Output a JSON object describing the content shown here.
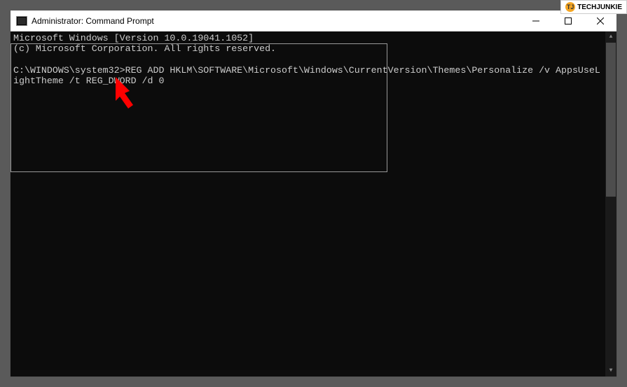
{
  "watermark": {
    "label": "TECHJUNKIE",
    "icon_letter": "TJ"
  },
  "titlebar": {
    "title": "Administrator: Command Prompt"
  },
  "console": {
    "line1": "Microsoft Windows [Version 10.0.19041.1052]",
    "line2": "(c) Microsoft Corporation. All rights reserved.",
    "blank1": "",
    "line3": "C:\\WINDOWS\\system32>REG ADD HKLM\\SOFTWARE\\Microsoft\\Windows\\CurrentVersion\\Themes\\Personalize /v AppsUseLightTheme /t REG_DWORD /d 0"
  }
}
